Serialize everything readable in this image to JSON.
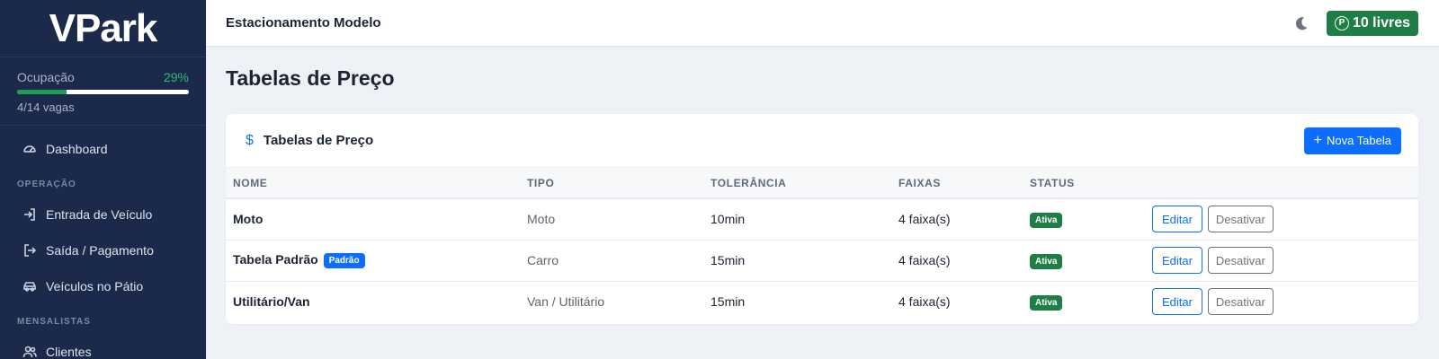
{
  "brand": "VPark",
  "occupancy": {
    "label": "Ocupação",
    "percent_text": "29%",
    "fraction": 0.29,
    "vagas": "4/14 vagas"
  },
  "sidebar": {
    "dashboard": "Dashboard",
    "section_operacao": "OPERAÇÃO",
    "entrada": "Entrada de Veículo",
    "saida": "Saída / Pagamento",
    "patio": "Veículos no Pátio",
    "section_mensalistas": "MENSALISTAS",
    "clientes": "Clientes"
  },
  "topbar": {
    "title": "Estacionamento Modelo",
    "free_label": "10 livres",
    "parking_glyph": "P",
    "theme_icon": "moon-icon"
  },
  "page": {
    "title": "Tabelas de Preço"
  },
  "card": {
    "title": "Tabelas de Preço",
    "icon": "$",
    "new_button": "Nova Tabela"
  },
  "table": {
    "headers": {
      "nome": "NOME",
      "tipo": "TIPO",
      "tolerancia": "TOLERÂNCIA",
      "faixas": "FAIXAS",
      "status": "STATUS"
    },
    "rows": [
      {
        "nome": "Moto",
        "badge": "",
        "tipo": "Moto",
        "tolerancia": "10min",
        "faixas": "4 faixa(s)",
        "status": "Ativa",
        "edit": "Editar",
        "disable": "Desativar"
      },
      {
        "nome": "Tabela Padrão",
        "badge": "Padrão",
        "tipo": "Carro",
        "tolerancia": "15min",
        "faixas": "4 faixa(s)",
        "status": "Ativa",
        "edit": "Editar",
        "disable": "Desativar"
      },
      {
        "nome": "Utilitário/Van",
        "badge": "",
        "tipo": "Van / Utilitário",
        "tolerancia": "15min",
        "faixas": "4 faixa(s)",
        "status": "Ativa",
        "edit": "Editar",
        "disable": "Desativar"
      }
    ]
  },
  "colors": {
    "sidebar": "#1b2a4a",
    "primary": "#0d6efd",
    "success": "#1e7e45"
  }
}
